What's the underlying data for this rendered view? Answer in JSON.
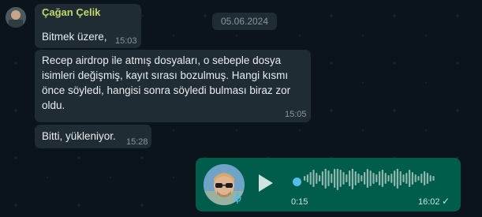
{
  "messages": [
    {
      "sender": "Çağan Çelik",
      "text": "Bitmek üzere,",
      "time": "15:03"
    },
    {
      "lines": [
        "Recep airdrop ile atmış dosyaları, o sebeple dosya",
        "isimleri değişmiş, kayıt sırası bozulmuş. Hangi kısmı",
        "önce söyledi, hangisi sonra söyledi bulması biraz zor",
        "oldu."
      ],
      "time": "15:05"
    },
    {
      "text": "Bitti, yükleniyor.",
      "time": "15:28"
    }
  ],
  "date_chip": "05.06.2024",
  "voice_note": {
    "elapsed": "0:15",
    "time": "16:02",
    "status_icon": "check-icon",
    "progress_fraction": 0.0
  },
  "colors": {
    "background": "#0b141a",
    "incoming_bubble": "#202c33",
    "outgoing_bubble": "#005c4b",
    "sender_name": "#c2d86a",
    "accent": "#53bdeb"
  }
}
